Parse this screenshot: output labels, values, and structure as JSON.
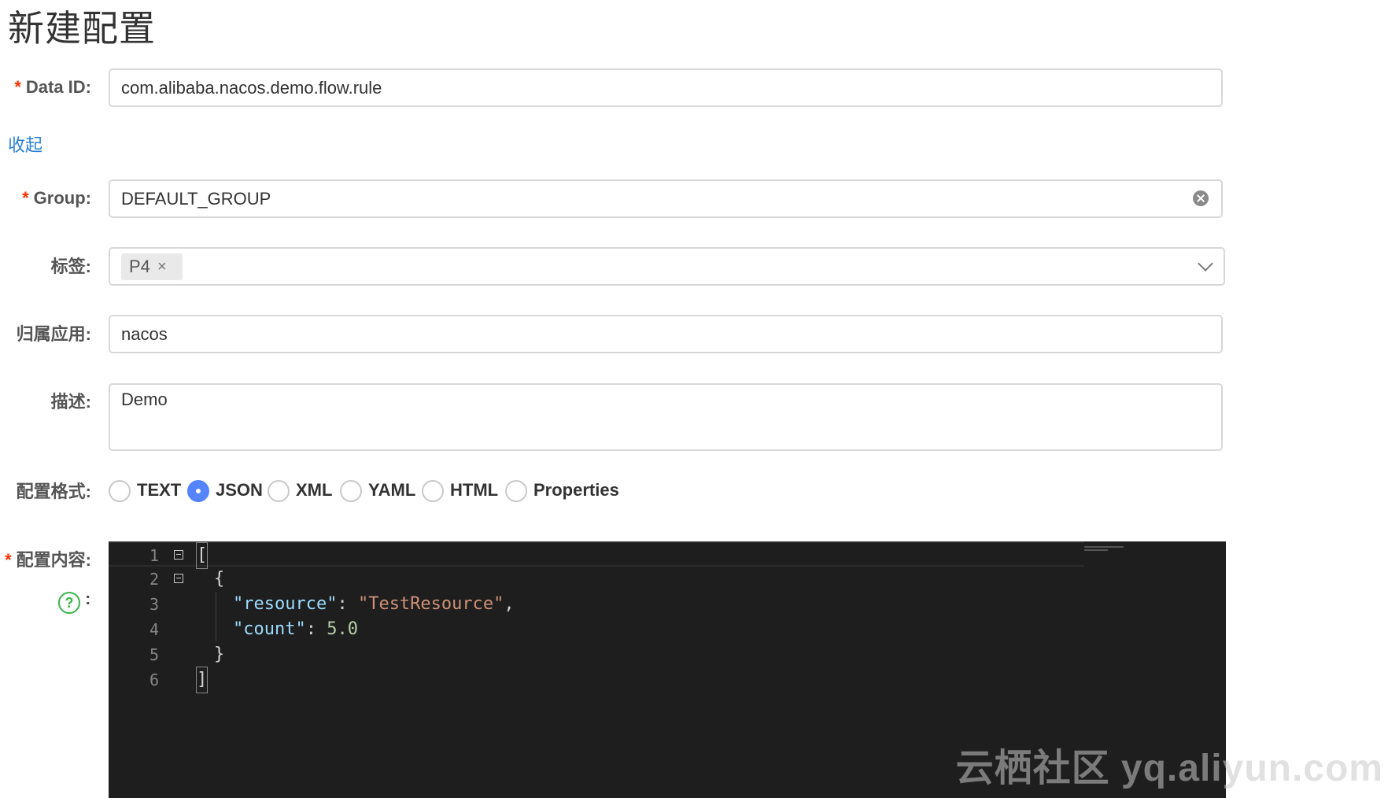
{
  "page_title": "新建配置",
  "form": {
    "required_mark": "*",
    "data_id": {
      "label": "Data ID:",
      "value": "com.alibaba.nacos.demo.flow.rule"
    },
    "toggle_link": "收起",
    "group": {
      "label": "Group:",
      "value": "DEFAULT_GROUP",
      "clear_icon": "clear-circle-icon"
    },
    "tags": {
      "label": "标签:",
      "items": [
        {
          "label": "P4",
          "close": "×"
        }
      ],
      "dropdown_icon": "chevron-down-icon"
    },
    "app": {
      "label": "归属应用:",
      "value": "nacos"
    },
    "description": {
      "label": "描述:",
      "value": "Demo"
    },
    "format": {
      "label": "配置格式:",
      "options": [
        "TEXT",
        "JSON",
        "XML",
        "YAML",
        "HTML",
        "Properties"
      ],
      "selected": "JSON"
    },
    "content": {
      "label": "配置内容:",
      "help_icon": "question-circle-icon",
      "help_colon": ":",
      "lines": [
        {
          "no": "1",
          "text": "["
        },
        {
          "no": "2",
          "text": "{"
        },
        {
          "no": "3",
          "key": "\"resource\"",
          "colon": ": ",
          "value": "\"TestResource\"",
          "comma": ","
        },
        {
          "no": "4",
          "key": "\"count\"",
          "colon": ": ",
          "value": "5.0",
          "comma": ""
        },
        {
          "no": "5",
          "text": "}"
        },
        {
          "no": "6",
          "text": "]"
        }
      ]
    }
  },
  "watermark": "云栖社区 yq.aliyun.com",
  "colors": {
    "accent": "#5584ff",
    "link": "#2a7fd4",
    "required": "#ff3000",
    "editor_bg": "#1e1e1e",
    "help": "#39b54a"
  }
}
